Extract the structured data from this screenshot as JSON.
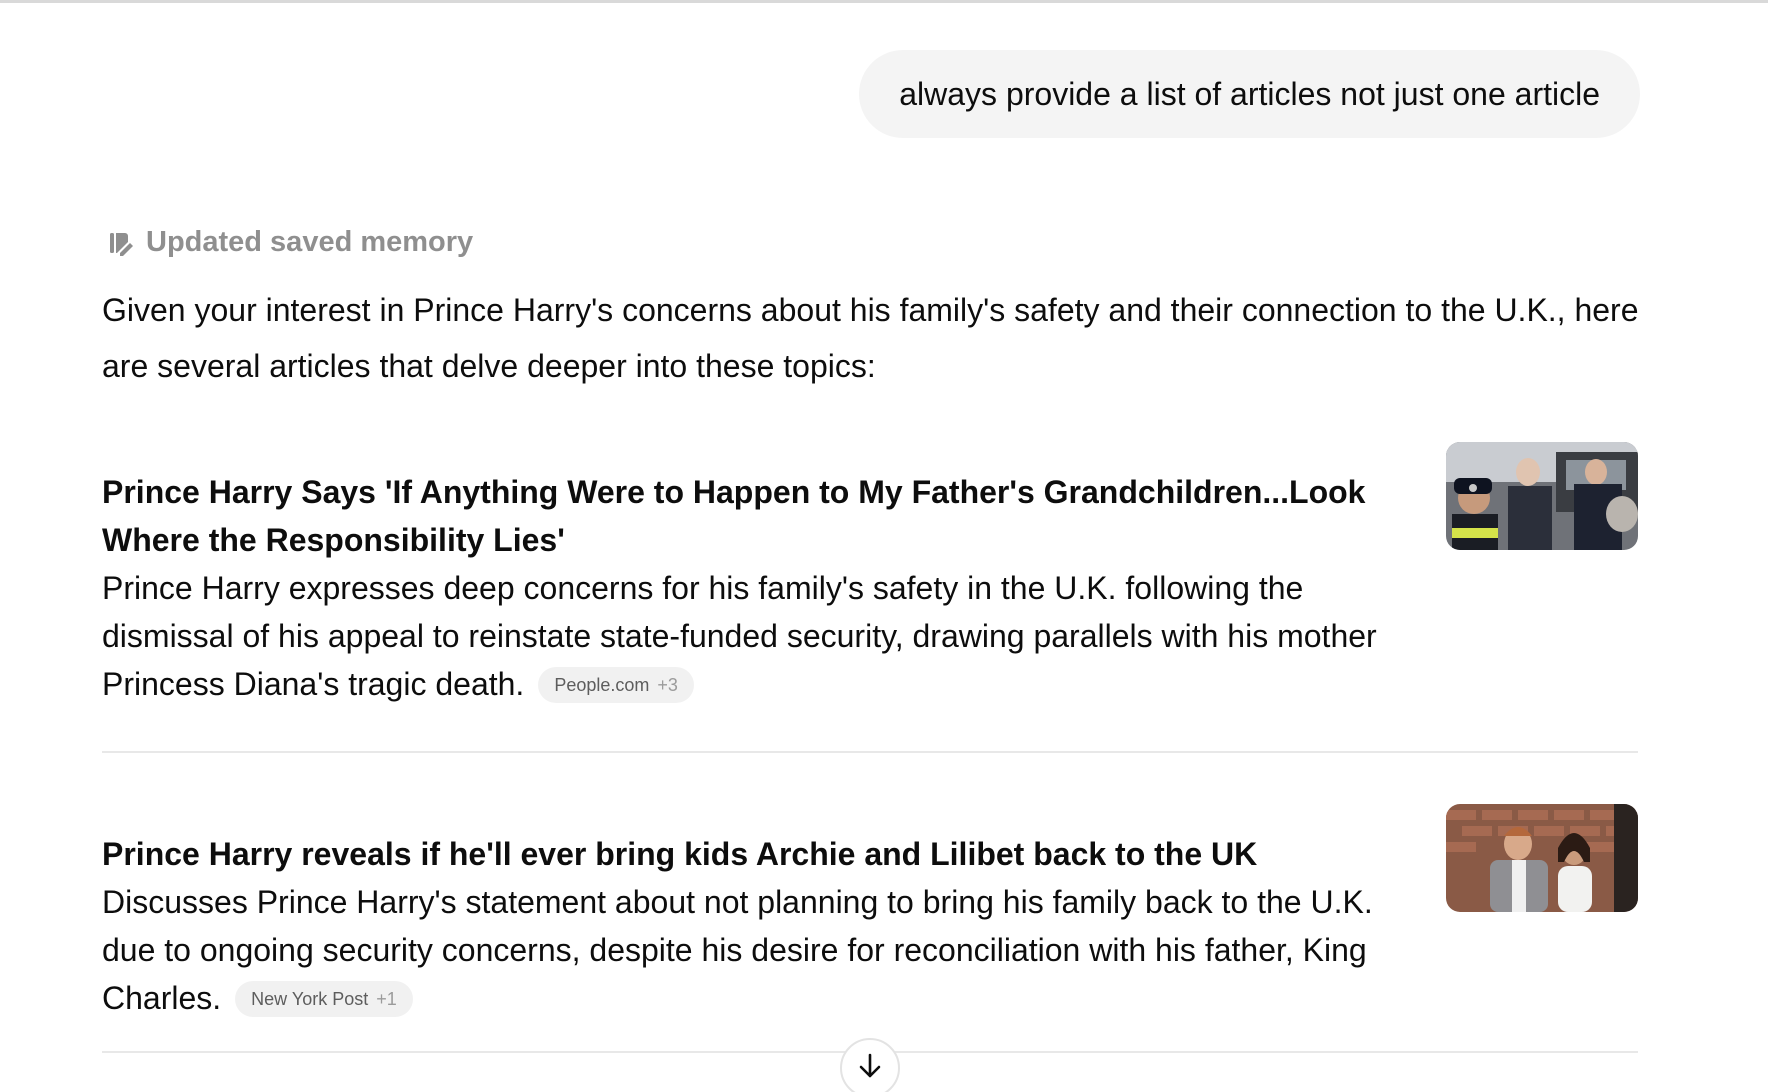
{
  "user_message": "always provide a list of articles not just one article",
  "memory_status": {
    "label": "Updated saved memory",
    "icon": "memory-edit-icon"
  },
  "response": {
    "intro": "Given your interest in Prince Harry's concerns about his family's safety and their connection to the U.K., here are several articles that delve deeper into these topics:",
    "articles": [
      {
        "title": "Prince Harry Says 'If Anything Were to Happen to My Father's Grandchildren...Look Where the Responsibility Lies'",
        "description": "Prince Harry expresses deep concerns for his family's safety in the U.K. following the dismissal of his appeal to reinstate state-funded security, drawing parallels with his mother Princess Diana's tragic death.",
        "source": "People.com",
        "source_extra": "+3"
      },
      {
        "title": "Prince Harry reveals if he'll ever bring kids Archie and Lilibet back to the UK",
        "description": "Discusses Prince Harry's statement about not planning to bring his family back to the U.K. due to ongoing security concerns, despite his desire for reconciliation with his father, King Charles.",
        "source": "New York Post",
        "source_extra": "+1"
      }
    ]
  },
  "scroll_button": {
    "icon": "arrow-down-icon"
  },
  "colors": {
    "bubble_bg": "#f4f4f4",
    "muted_text": "#8f8f8f",
    "chip_bg": "#f1f1f1",
    "divider": "#e8e8e8"
  }
}
